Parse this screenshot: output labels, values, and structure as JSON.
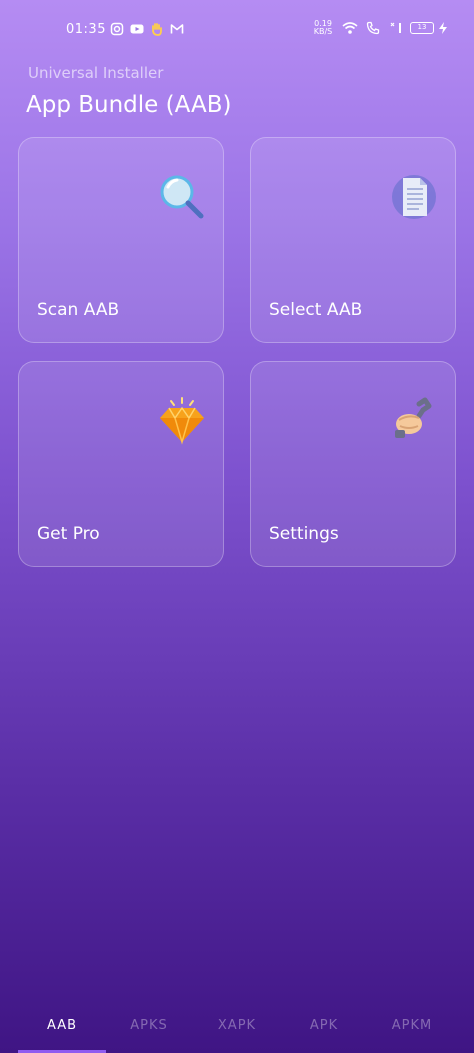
{
  "status_bar": {
    "time": "01:35",
    "left_icons": [
      "instagram-icon",
      "youtube-icon",
      "hand-icon",
      "gmail-icon"
    ],
    "speed_value": "0.19",
    "speed_unit": "KB/S",
    "battery": "13"
  },
  "header": {
    "subtitle": "Universal Installer",
    "title": "App Bundle (AAB)"
  },
  "cards": [
    {
      "label": "Scan AAB",
      "icon": "magnifier-icon"
    },
    {
      "label": "Select AAB",
      "icon": "document-icon"
    },
    {
      "label": "Get Pro",
      "icon": "diamond-icon"
    },
    {
      "label": "Settings",
      "icon": "wrench-hand-icon"
    }
  ],
  "tabs": [
    {
      "label": "AAB",
      "active": true
    },
    {
      "label": "APKS",
      "active": false
    },
    {
      "label": "XAPK",
      "active": false
    },
    {
      "label": "APK",
      "active": false
    },
    {
      "label": "APKM",
      "active": false
    }
  ]
}
